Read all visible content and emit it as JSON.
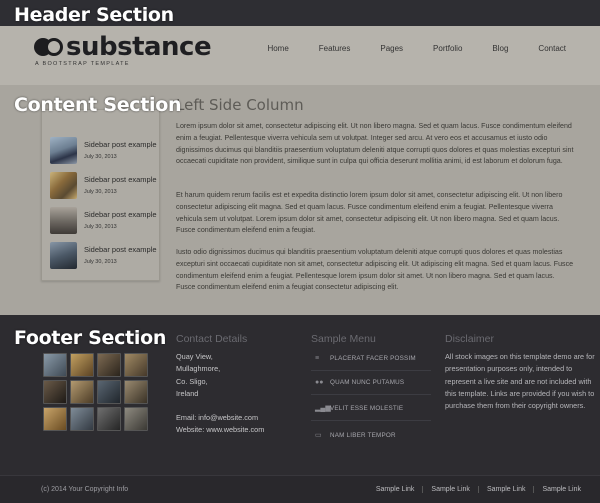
{
  "labels": {
    "header_section": "Header Section",
    "content_section": "Content Section",
    "footer_section": "Footer Section"
  },
  "header": {
    "logo_text": "substance",
    "logo_tagline": "A BOOTSTRAP TEMPLATE",
    "nav": [
      "Home",
      "Features",
      "Pages",
      "Portfolio",
      "Blog",
      "Contact"
    ]
  },
  "content": {
    "title": "Left Side Column",
    "paragraphs": [
      "Lorem ipsum dolor sit amet, consectetur adipiscing elit. Ut non libero magna. Sed et quam lacus. Fusce condimentum eleifend enim a feugiat. Pellentesque viverra vehicula sem ut volutpat. Integer sed arcu. At vero eos et accusamus et iusto odio dignissimos ducimus qui blanditiis praesentium voluptatum deleniti atque corrupti quos dolores et quas molestias excepturi sint occaecati cupiditate non provident, similique sunt in culpa qui officia deserunt mollitia animi, id est laborum et dolorum fuga.",
      "Et harum quidem rerum facilis est et expedita distinctio lorem ipsum dolor sit amet, consectetur adipiscing elit. Ut non libero consectetur adipiscing elit magna. Sed et quam lacus. Fusce condimentum eleifend enim a feugiat. Pellentesque viverra vehicula sem ut volutpat. Lorem ipsum dolor sit amet, consectetur adipiscing elit. Ut non libero magna. Sed et quam lacus. Fusce condimentum eleifend enim a feugiat.",
      "Iusto odio dignissimos ducimus qui blanditiis praesentium voluptatum deleniti atque corrupti quos dolores et quas molestias excepturi sint occaecati cupiditate non sit amet, consectetur adipiscing elit. Ut adipiscing elit magna. Sed et quam lacus. Fusce condimentum eleifend enim a feugiat. Pellentesque lorem ipsum dolor sit amet. Ut non libero magna. Sed et quam lacus. Fusce condimentum eleifend enim a feugiat consectetur adipiscing elit."
    ]
  },
  "sidebar": {
    "posts": [
      {
        "title": "Sidebar post example",
        "date": "July 30, 2013"
      },
      {
        "title": "Sidebar post example",
        "date": "July 30, 2013"
      },
      {
        "title": "Sidebar post example",
        "date": "July 30, 2013"
      },
      {
        "title": "Sidebar post example",
        "date": "July 30, 2013"
      }
    ]
  },
  "footer": {
    "contact": {
      "title": "Contact Details",
      "address": [
        "Quay View,",
        "Mullaghmore,",
        "Co. Sligo,",
        "Ireland"
      ],
      "email": "Email: info@website.com",
      "website": "Website: www.website.com"
    },
    "menu": {
      "title": "Sample Menu",
      "items": [
        "PLACERAT FACER POSSIM",
        "QUAM NUNC PUTAMUS",
        "VELIT ESSE MOLESTIE",
        "NAM LIBER TEMPOR"
      ]
    },
    "disclaimer": {
      "title": "Disclaimer",
      "text": "All stock images on this template demo are for presentation purposes only, intended to represent a live site and are not included with this template. Links are provided if you wish to purchase them from their copyright owners."
    }
  },
  "bottom": {
    "copyright": "(c) 2014 Your Copyright Info",
    "links": [
      "Sample Link",
      "Sample Link",
      "Sample Link",
      "Sample Link"
    ]
  },
  "colors": {
    "header_bg": "#b6b3ac",
    "content_bg": "#a8a59e",
    "footer_bg": "#2d2c30"
  },
  "icons": {
    "menu": [
      "list-icon",
      "users-icon",
      "bar-chart-icon",
      "chat-icon"
    ]
  }
}
